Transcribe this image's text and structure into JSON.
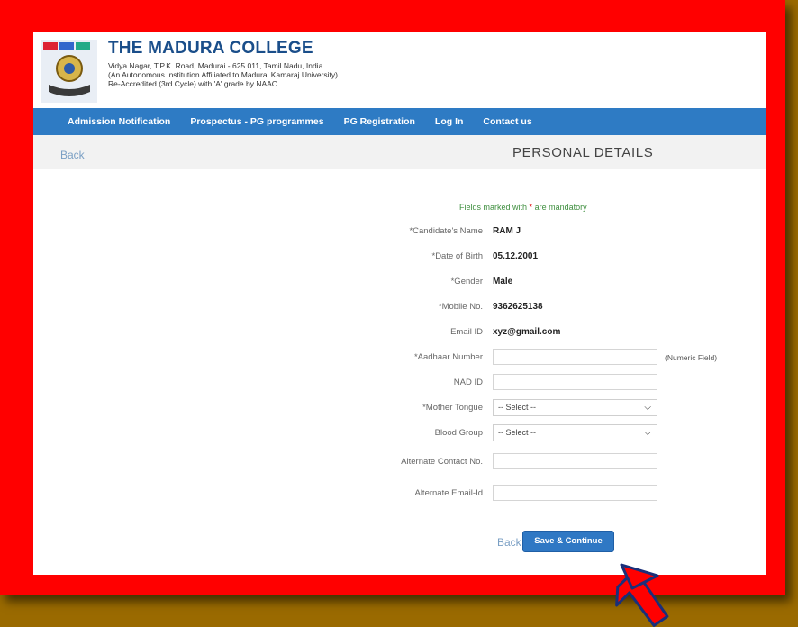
{
  "header": {
    "college_name": "THE MADURA COLLEGE",
    "address_lines": [
      "Vidya Nagar, T.P.K. Road, Madurai - 625 011, Tamil Nadu, India",
      "(An Autonomous Institution Affiliated to Madurai Kamaraj University)",
      "Re-Accredited (3rd Cycle) with 'A' grade by NAAC"
    ]
  },
  "nav": {
    "items": [
      "Admission Notification",
      "Prospectus - PG programmes",
      "PG Registration",
      "Log In",
      "Contact us"
    ]
  },
  "subbar": {
    "back": "Back",
    "title": "PERSONAL DETAILS"
  },
  "form": {
    "note_prefix": "Fields marked with",
    "note_star": "*",
    "note_suffix": "are mandatory",
    "candidate_name_label": "*Candidate's Name",
    "candidate_name": "RAM J",
    "dob_label": "*Date of Birth",
    "dob": "05.12.2001",
    "gender_label": "*Gender",
    "gender": "Male",
    "mobile_label": "*Mobile No.",
    "mobile": "9362625138",
    "email_label": "Email ID",
    "email": "xyz@gmail.com",
    "aadhaar_label": "*Aadhaar Number",
    "aadhaar_value": "",
    "aadhaar_hint": "(Numeric Field)",
    "nad_label": "NAD ID",
    "nad_value": "",
    "mother_tongue_label": "*Mother Tongue",
    "mother_tongue_selected": "-- Select --",
    "blood_group_label": "Blood Group",
    "blood_group_selected": "-- Select --",
    "alt_contact_label": "Alternate Contact No.",
    "alt_contact_value": "",
    "alt_email_label": "Alternate Email-Id",
    "alt_email_value": ""
  },
  "actions": {
    "back": "Back",
    "save": "Save & Continue"
  },
  "colors": {
    "navbar": "#2e7bc4",
    "frame": "#ff0000",
    "background": "#9a6a00",
    "arrow": "#ff0000"
  }
}
